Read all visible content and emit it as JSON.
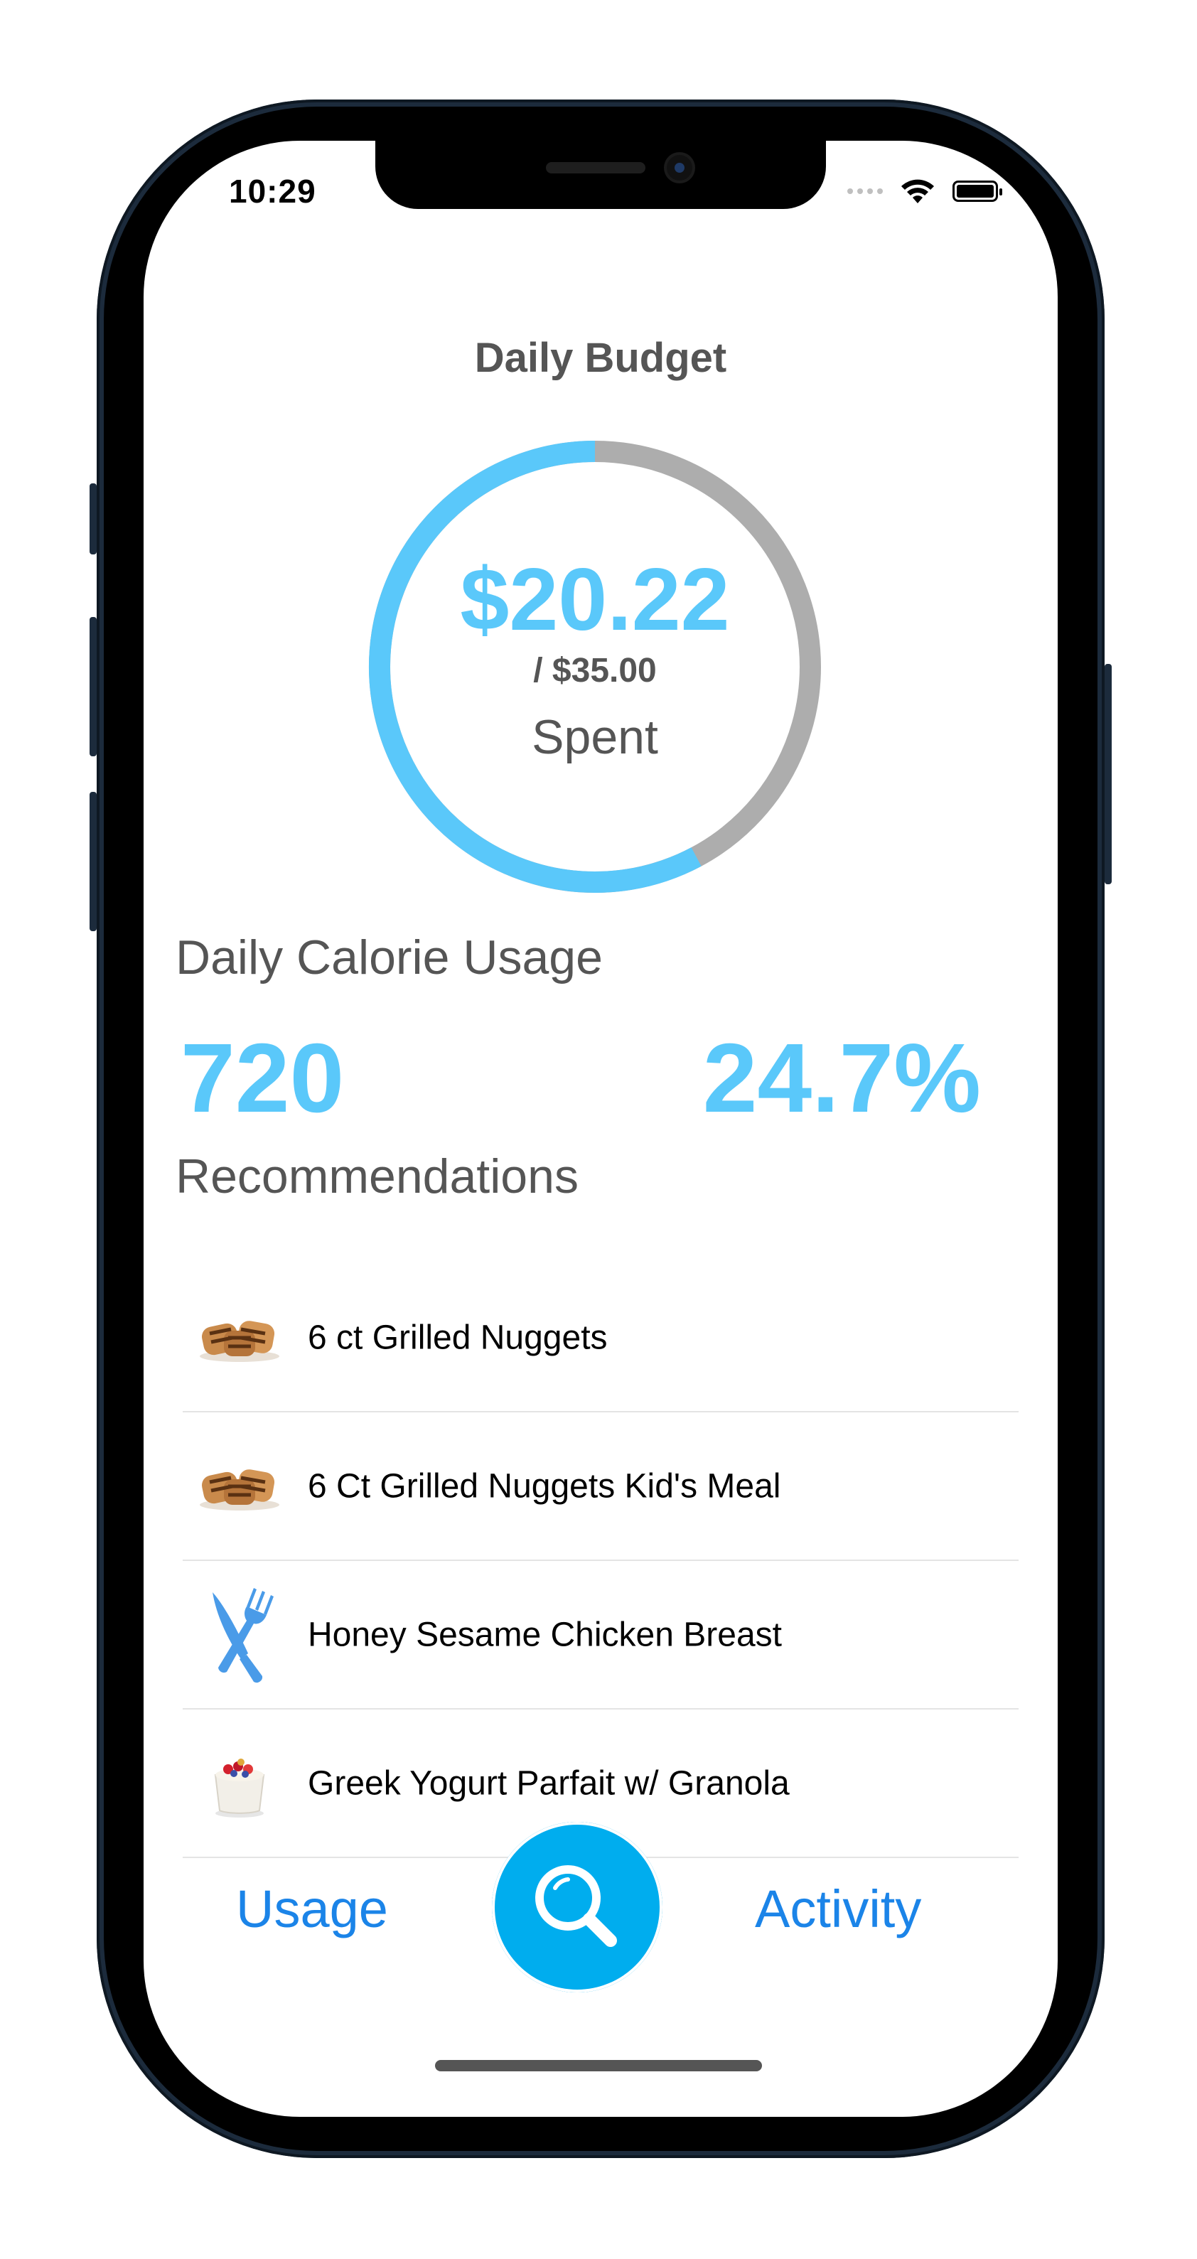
{
  "status_bar": {
    "time": "10:29"
  },
  "budget": {
    "title": "Daily Budget",
    "spent_amount": "$20.22",
    "total": "/  $35.00",
    "spent_label": "Spent",
    "spent_fraction": 0.578,
    "ring_color": "#5ac8fa",
    "track_color": "#adadad"
  },
  "calories": {
    "label": "Daily Calorie Usage",
    "count": "720",
    "percent": "24.7%"
  },
  "recommendations": {
    "label": "Recommendations",
    "items": [
      {
        "label": "6 ct Grilled Nuggets",
        "icon": "grilled-nuggets-photo"
      },
      {
        "label": "6 Ct Grilled Nuggets Kid's Meal",
        "icon": "grilled-nuggets-photo"
      },
      {
        "label": "Honey Sesame Chicken Breast",
        "icon": "fork-knife-icon"
      },
      {
        "label": "Greek Yogurt Parfait w/ Granola",
        "icon": "yogurt-parfait-photo"
      }
    ]
  },
  "tabbar": {
    "usage_label": "Usage",
    "activity_label": "Activity",
    "search_icon": "search-icon",
    "accent": "#00adee"
  }
}
